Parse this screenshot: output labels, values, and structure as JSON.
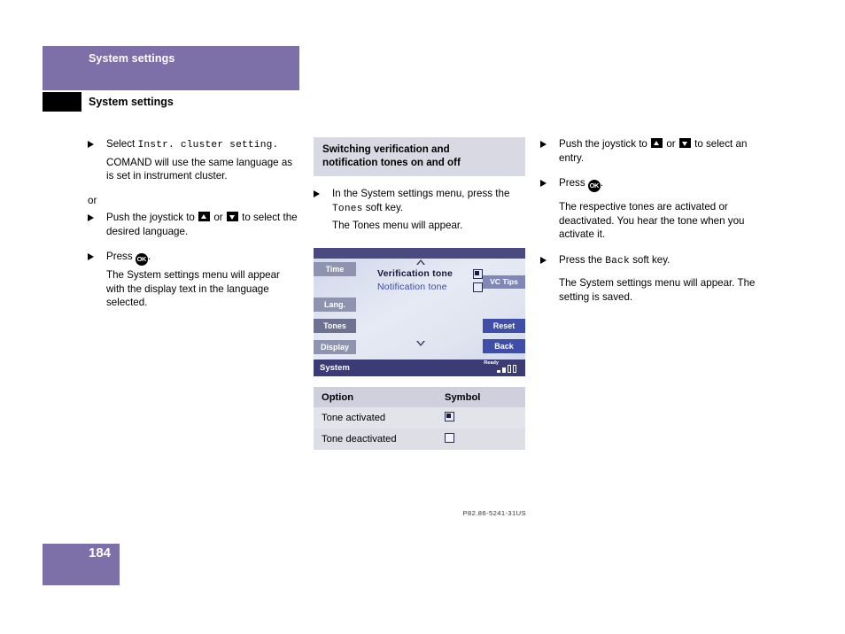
{
  "header": {
    "band_title": "System settings",
    "sub_title": "System settings"
  },
  "page_number": "184",
  "col1": {
    "item1": {
      "lead": "Select ",
      "mono": "Instr. cluster setting.",
      "body": "COMAND will use the same language as is set in instrument cluster."
    },
    "or": "or",
    "item2": {
      "pre": "Push the joystick to ",
      "mid": " or ",
      "post": " to select the desired language."
    },
    "item3": {
      "pre": "Press ",
      "key": "OK",
      "post": ".",
      "body": "The System settings menu will appear with the display text in the language selected."
    }
  },
  "col2": {
    "heading_line1": "Switching verification and",
    "heading_line2": "notification tones on and off",
    "item1": {
      "pre": "In the System settings menu, press the ",
      "mono": "Tones",
      "post": " soft key.",
      "body": "The Tones menu will appear."
    },
    "screen": {
      "softkeys": {
        "time": "Time",
        "lang": "Lang.",
        "tones": "Tones",
        "display": "Display",
        "reset": "Reset",
        "back": "Back",
        "vc_tips": "VC Tips"
      },
      "rows": [
        {
          "label": "Verification tone",
          "state": "activated"
        },
        {
          "label": "Notification tone",
          "state": "deactivated"
        }
      ],
      "status_label": "System",
      "ready": "Ready",
      "part_number": "P82.86-5241-31US"
    },
    "table": {
      "headers": [
        "Option",
        "Symbol"
      ],
      "rows": [
        {
          "option": "Tone activated",
          "symbol": "checkbox-filled"
        },
        {
          "option": "Tone deactivated",
          "symbol": "checkbox-empty"
        }
      ]
    }
  },
  "col3": {
    "item1": {
      "pre": "Push the joystick to ",
      "mid": " or ",
      "post": " to select an entry."
    },
    "item2": {
      "pre": "Press ",
      "key": "OK",
      "post": ".",
      "body": "The respective tones are activated or deactivated. You hear the tone when you activate it."
    },
    "item3": {
      "pre": "Press the ",
      "mono": "Back",
      "post": " soft key.",
      "body": "The System settings menu will appear. The setting is saved."
    }
  },
  "colors": {
    "brand_purple": "#7d6fa8",
    "table_header": "#cfcfdd",
    "screen_blue": "#3f4fa8"
  }
}
